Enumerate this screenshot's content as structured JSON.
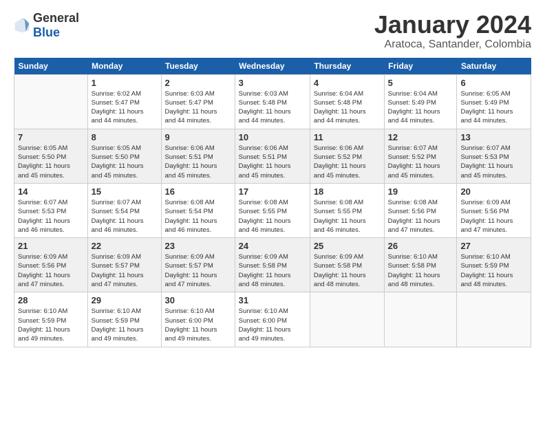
{
  "header": {
    "logo_general": "General",
    "logo_blue": "Blue",
    "title": "January 2024",
    "subtitle": "Aratoca, Santander, Colombia"
  },
  "weekdays": [
    "Sunday",
    "Monday",
    "Tuesday",
    "Wednesday",
    "Thursday",
    "Friday",
    "Saturday"
  ],
  "weeks": [
    [
      {
        "num": "",
        "info": ""
      },
      {
        "num": "1",
        "info": "Sunrise: 6:02 AM\nSunset: 5:47 PM\nDaylight: 11 hours\nand 44 minutes."
      },
      {
        "num": "2",
        "info": "Sunrise: 6:03 AM\nSunset: 5:47 PM\nDaylight: 11 hours\nand 44 minutes."
      },
      {
        "num": "3",
        "info": "Sunrise: 6:03 AM\nSunset: 5:48 PM\nDaylight: 11 hours\nand 44 minutes."
      },
      {
        "num": "4",
        "info": "Sunrise: 6:04 AM\nSunset: 5:48 PM\nDaylight: 11 hours\nand 44 minutes."
      },
      {
        "num": "5",
        "info": "Sunrise: 6:04 AM\nSunset: 5:49 PM\nDaylight: 11 hours\nand 44 minutes."
      },
      {
        "num": "6",
        "info": "Sunrise: 6:05 AM\nSunset: 5:49 PM\nDaylight: 11 hours\nand 44 minutes."
      }
    ],
    [
      {
        "num": "7",
        "info": "Sunrise: 6:05 AM\nSunset: 5:50 PM\nDaylight: 11 hours\nand 45 minutes."
      },
      {
        "num": "8",
        "info": "Sunrise: 6:05 AM\nSunset: 5:50 PM\nDaylight: 11 hours\nand 45 minutes."
      },
      {
        "num": "9",
        "info": "Sunrise: 6:06 AM\nSunset: 5:51 PM\nDaylight: 11 hours\nand 45 minutes."
      },
      {
        "num": "10",
        "info": "Sunrise: 6:06 AM\nSunset: 5:51 PM\nDaylight: 11 hours\nand 45 minutes."
      },
      {
        "num": "11",
        "info": "Sunrise: 6:06 AM\nSunset: 5:52 PM\nDaylight: 11 hours\nand 45 minutes."
      },
      {
        "num": "12",
        "info": "Sunrise: 6:07 AM\nSunset: 5:52 PM\nDaylight: 11 hours\nand 45 minutes."
      },
      {
        "num": "13",
        "info": "Sunrise: 6:07 AM\nSunset: 5:53 PM\nDaylight: 11 hours\nand 45 minutes."
      }
    ],
    [
      {
        "num": "14",
        "info": "Sunrise: 6:07 AM\nSunset: 5:53 PM\nDaylight: 11 hours\nand 46 minutes."
      },
      {
        "num": "15",
        "info": "Sunrise: 6:07 AM\nSunset: 5:54 PM\nDaylight: 11 hours\nand 46 minutes."
      },
      {
        "num": "16",
        "info": "Sunrise: 6:08 AM\nSunset: 5:54 PM\nDaylight: 11 hours\nand 46 minutes."
      },
      {
        "num": "17",
        "info": "Sunrise: 6:08 AM\nSunset: 5:55 PM\nDaylight: 11 hours\nand 46 minutes."
      },
      {
        "num": "18",
        "info": "Sunrise: 6:08 AM\nSunset: 5:55 PM\nDaylight: 11 hours\nand 46 minutes."
      },
      {
        "num": "19",
        "info": "Sunrise: 6:08 AM\nSunset: 5:56 PM\nDaylight: 11 hours\nand 47 minutes."
      },
      {
        "num": "20",
        "info": "Sunrise: 6:09 AM\nSunset: 5:56 PM\nDaylight: 11 hours\nand 47 minutes."
      }
    ],
    [
      {
        "num": "21",
        "info": "Sunrise: 6:09 AM\nSunset: 5:56 PM\nDaylight: 11 hours\nand 47 minutes."
      },
      {
        "num": "22",
        "info": "Sunrise: 6:09 AM\nSunset: 5:57 PM\nDaylight: 11 hours\nand 47 minutes."
      },
      {
        "num": "23",
        "info": "Sunrise: 6:09 AM\nSunset: 5:57 PM\nDaylight: 11 hours\nand 47 minutes."
      },
      {
        "num": "24",
        "info": "Sunrise: 6:09 AM\nSunset: 5:58 PM\nDaylight: 11 hours\nand 48 minutes."
      },
      {
        "num": "25",
        "info": "Sunrise: 6:09 AM\nSunset: 5:58 PM\nDaylight: 11 hours\nand 48 minutes."
      },
      {
        "num": "26",
        "info": "Sunrise: 6:10 AM\nSunset: 5:58 PM\nDaylight: 11 hours\nand 48 minutes."
      },
      {
        "num": "27",
        "info": "Sunrise: 6:10 AM\nSunset: 5:59 PM\nDaylight: 11 hours\nand 48 minutes."
      }
    ],
    [
      {
        "num": "28",
        "info": "Sunrise: 6:10 AM\nSunset: 5:59 PM\nDaylight: 11 hours\nand 49 minutes."
      },
      {
        "num": "29",
        "info": "Sunrise: 6:10 AM\nSunset: 5:59 PM\nDaylight: 11 hours\nand 49 minutes."
      },
      {
        "num": "30",
        "info": "Sunrise: 6:10 AM\nSunset: 6:00 PM\nDaylight: 11 hours\nand 49 minutes."
      },
      {
        "num": "31",
        "info": "Sunrise: 6:10 AM\nSunset: 6:00 PM\nDaylight: 11 hours\nand 49 minutes."
      },
      {
        "num": "",
        "info": ""
      },
      {
        "num": "",
        "info": ""
      },
      {
        "num": "",
        "info": ""
      }
    ]
  ]
}
